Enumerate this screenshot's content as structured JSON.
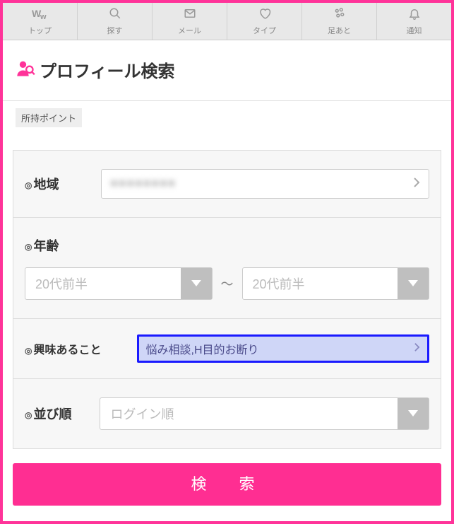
{
  "nav": {
    "top": {
      "label": "トップ"
    },
    "search": {
      "label": "探す"
    },
    "mail": {
      "label": "メール"
    },
    "type": {
      "label": "タイプ"
    },
    "foot": {
      "label": "足あと"
    },
    "notice": {
      "label": "通知"
    }
  },
  "page": {
    "title": "プロフィール検索"
  },
  "points_badge": "所持ポイント",
  "form": {
    "region": {
      "label": "地域",
      "value": "■■■■■■■■"
    },
    "age": {
      "label": "年齢",
      "from": "20代前半",
      "to": "20代前半",
      "separator": "〜"
    },
    "interest": {
      "label": "興味あること",
      "value": "悩み相談,H目的お断り"
    },
    "sort": {
      "label": "並び順",
      "value": "ログイン順"
    }
  },
  "search_button": "検　索"
}
